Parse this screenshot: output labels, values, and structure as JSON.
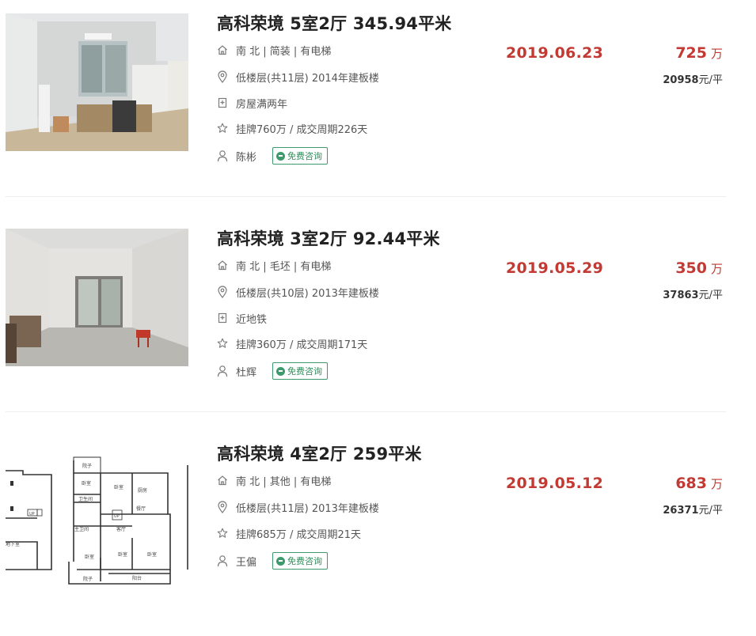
{
  "listings": [
    {
      "title": "高科荣境 5室2厅 345.94平米",
      "house_info": "南 北 | 简装 | 有电梯",
      "floor_info": "低楼层(共11层) 2014年建板楼",
      "tag": "房屋满两年",
      "deal_info": "挂牌760万 / 成交周期226天",
      "agent": "陈彬",
      "consult_label": "免费咨询",
      "date": "2019.06.23",
      "price": "725",
      "price_unit": "万",
      "unit_price_value": "20958",
      "unit_price_suffix": "元/平",
      "image": "living-room-photo"
    },
    {
      "title": "高科荣境 3室2厅 92.44平米",
      "house_info": "南 北 | 毛坯 | 有电梯",
      "floor_info": "低楼层(共10层) 2013年建板楼",
      "tag": "近地铁",
      "deal_info": "挂牌360万 / 成交周期171天",
      "agent": "杜辉",
      "consult_label": "免费咨询",
      "date": "2019.05.29",
      "price": "350",
      "price_unit": "万",
      "unit_price_value": "37863",
      "unit_price_suffix": "元/平",
      "image": "empty-room-photo"
    },
    {
      "title": "高科荣境 4室2厅 259平米",
      "house_info": "南 北 | 其他 | 有电梯",
      "floor_info": "低楼层(共11层) 2013年建板楼",
      "deal_info": "挂牌685万 / 成交周期21天",
      "agent": "王偏",
      "consult_label": "免费咨询",
      "date": "2019.05.12",
      "price": "683",
      "price_unit": "万",
      "unit_price_value": "26371",
      "unit_price_suffix": "元/平",
      "image": "floor-plan",
      "floor_plan_labels": {
        "courtyard_top": "院子",
        "bedroom_a": "卧室",
        "bedroom_b": "卧室",
        "kitchen": "厨房",
        "bathroom": "卫生间",
        "dining": "餐厅",
        "up_left": "UP",
        "up_mid": "UP",
        "living": "客厅",
        "master_bath": "主卫间",
        "basement": "地下室",
        "bedroom_c": "卧室",
        "bedroom_d": "卧室",
        "bedroom_e": "卧室",
        "balcony": "阳台",
        "courtyard_bottom": "院子"
      }
    }
  ],
  "colors": {
    "accent_red": "#c23a33",
    "consult_green": "#3c9a6c",
    "divider": "#eeeeee"
  },
  "icons": [
    "house-icon",
    "location-pin-icon",
    "shield-tag-icon",
    "star-icon",
    "user-icon",
    "chat-bubble-icon"
  ]
}
